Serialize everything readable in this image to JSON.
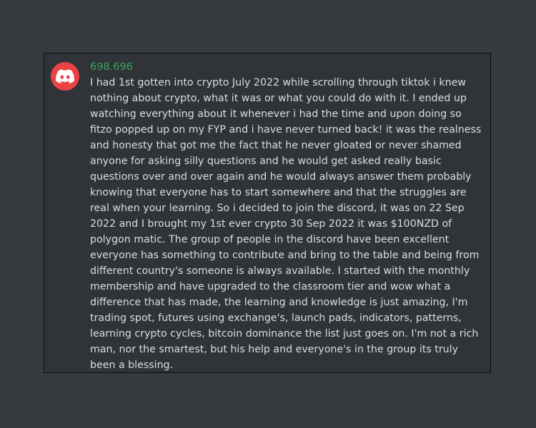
{
  "author": {
    "avatar_icon": "discord-logo-icon",
    "avatar_color": "#ed4245",
    "username": "698.696",
    "username_color": "#3ba55d"
  },
  "message": {
    "text": "I had 1st gotten into crypto July 2022 while scrolling through tiktok i knew\nnothing about crypto, what it was or what you could do with it. I ended up\nwatching everything about it whenever i had the time and upon doing so\nfitzo popped up on my FYP and i have never turned back! it was the realness\nand honesty that got me the fact that he never gloated or never shamed\nanyone for asking silly questions and he would get asked really basic\nquestions over and over again and he would always answer them probably\nknowing that everyone has to start somewhere and that the struggles are\nreal when your learning. So i decided to join the discord, it was on 22 Sep\n2022 and I brought my 1st ever crypto 30 Sep 2022 it was $100NZD of\npolygon matic. The group of people in the discord have been excellent\neveryone has something to contribute and bring to the table and being from\ndifferent country's someone is always available. I started with the monthly\nmembership and have upgraded to the classroom tier and wow what a\ndifference that has made, the learning and knowledge is just amazing, I'm\ntrading spot, futures using exchange's, launch pads, indicators, patterns,\nlearning crypto cycles, bitcoin dominance the list just goes on. I'm not a rich\nman, nor the smartest, but his help and everyone's in the group its truly\nbeen a blessing."
  },
  "theme": {
    "page_background": "#363a3f",
    "card_background": "#303338",
    "text_color": "#dcddde"
  }
}
